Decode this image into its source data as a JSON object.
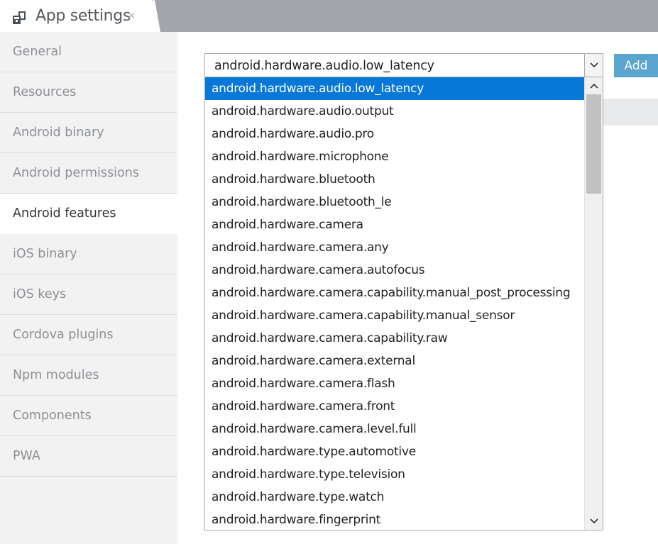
{
  "tab": {
    "title": "App settings",
    "close_glyph": "×",
    "icon": "app-settings-icon"
  },
  "sidebar": {
    "items": [
      {
        "label": "General",
        "active": false
      },
      {
        "label": "Resources",
        "active": false
      },
      {
        "label": "Android binary",
        "active": false
      },
      {
        "label": "Android permissions",
        "active": false
      },
      {
        "label": "Android features",
        "active": true
      },
      {
        "label": "iOS binary",
        "active": false
      },
      {
        "label": "iOS keys",
        "active": false
      },
      {
        "label": "Cordova plugins",
        "active": false
      },
      {
        "label": "Npm modules",
        "active": false
      },
      {
        "label": "Components",
        "active": false
      },
      {
        "label": "PWA",
        "active": false
      }
    ]
  },
  "feature_select": {
    "value": "android.hardware.audio.low_latency",
    "options": [
      "android.hardware.audio.low_latency",
      "android.hardware.audio.output",
      "android.hardware.audio.pro",
      "android.hardware.microphone",
      "android.hardware.bluetooth",
      "android.hardware.bluetooth_le",
      "android.hardware.camera",
      "android.hardware.camera.any",
      "android.hardware.camera.autofocus",
      "android.hardware.camera.capability.manual_post_processing",
      "android.hardware.camera.capability.manual_sensor",
      "android.hardware.camera.capability.raw",
      "android.hardware.camera.external",
      "android.hardware.camera.flash",
      "android.hardware.camera.front",
      "android.hardware.camera.level.full",
      "android.hardware.type.automotive",
      "android.hardware.type.television",
      "android.hardware.type.watch",
      "android.hardware.fingerprint"
    ],
    "selected_index": 0
  },
  "add_button": {
    "label": "Add"
  },
  "colors": {
    "tabbar_bg": "#a3a7ab",
    "sidebar_bg": "#f2f2f2",
    "accent_button": "#5aa5cf",
    "selected_option": "#0778d7"
  }
}
